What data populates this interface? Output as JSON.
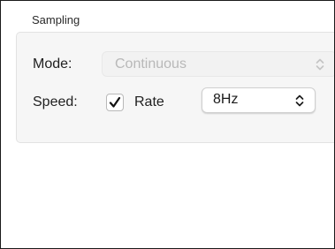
{
  "group": {
    "title": "Sampling"
  },
  "mode": {
    "label": "Mode:",
    "value": "Continuous",
    "enabled": false
  },
  "speed": {
    "label": "Speed:",
    "checkbox_checked": true,
    "checkbox_label": "Rate",
    "rate_value": "8Hz"
  },
  "icons": {
    "check": "checkmark-icon",
    "popup_arrows": "chevron-up-down-icon"
  },
  "colors": {
    "group_background": "#f6f6f6",
    "disabled_text": "#b8b8b8",
    "text": "#1f1f1f"
  }
}
